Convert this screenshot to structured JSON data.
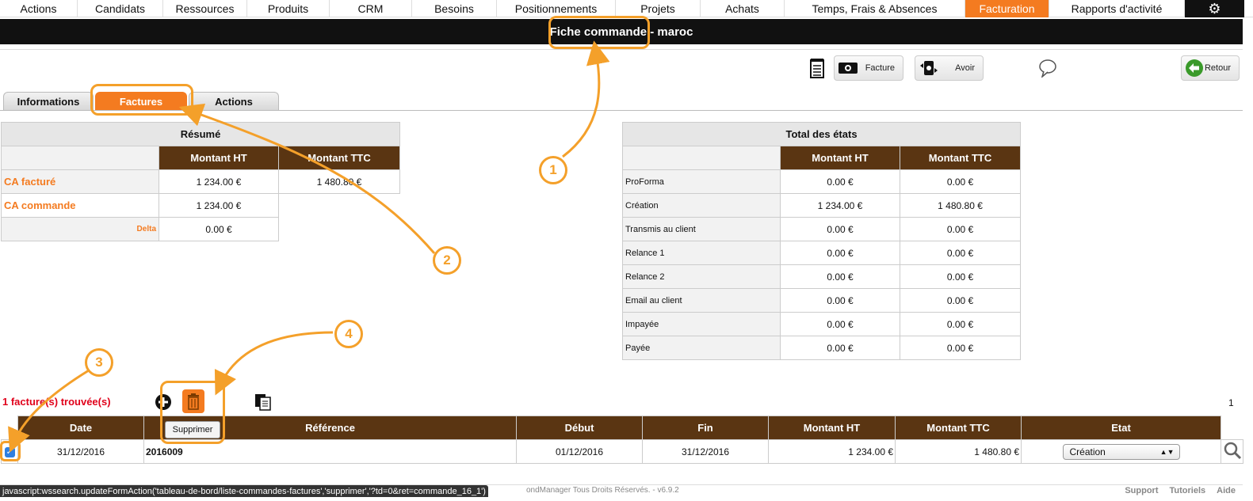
{
  "nav": {
    "items": [
      "Actions",
      "Candidats",
      "Ressources",
      "Produits",
      "CRM",
      "Besoins",
      "Positionnements",
      "Projets",
      "Achats",
      "Temps, Frais & Absences",
      "Facturation",
      "Rapports d'activité"
    ],
    "active": "Facturation",
    "gear_icon": "gear-icon"
  },
  "title": "Fiche commande - maroc",
  "toolbar": {
    "facture_label": "Facture",
    "avoir_label": "Avoir",
    "retour_label": "Retour"
  },
  "tabs": [
    "Informations",
    "Factures",
    "Actions"
  ],
  "active_tab": "Factures",
  "resume": {
    "title": "Résumé",
    "col_ht": "Montant HT",
    "col_ttc": "Montant TTC",
    "rows": [
      {
        "label": "CA facturé",
        "ht": "1 234.00 €",
        "ttc": "1 480.80 €"
      },
      {
        "label": "CA commande",
        "ht": "1 234.00 €",
        "ttc": ""
      },
      {
        "label": "Delta",
        "ht": "0.00 €",
        "ttc": ""
      }
    ]
  },
  "etats": {
    "title": "Total des états",
    "col_ht": "Montant HT",
    "col_ttc": "Montant TTC",
    "rows": [
      {
        "label": "ProForma",
        "ht": "0.00 €",
        "ttc": "0.00 €"
      },
      {
        "label": "Création",
        "ht": "1 234.00 €",
        "ttc": "1 480.80 €"
      },
      {
        "label": "Transmis au client",
        "ht": "0.00 €",
        "ttc": "0.00 €"
      },
      {
        "label": "Relance 1",
        "ht": "0.00 €",
        "ttc": "0.00 €"
      },
      {
        "label": "Relance 2",
        "ht": "0.00 €",
        "ttc": "0.00 €"
      },
      {
        "label": "Email au client",
        "ht": "0.00 €",
        "ttc": "0.00 €"
      },
      {
        "label": "Impayée",
        "ht": "0.00 €",
        "ttc": "0.00 €"
      },
      {
        "label": "Payée",
        "ht": "0.00 €",
        "ttc": "0.00 €"
      }
    ]
  },
  "results": {
    "found_text": "1 facture(s) trouvée(s)",
    "page": "1",
    "tooltip": "Supprimer",
    "columns": [
      "Date",
      "Référence",
      "Début",
      "Fin",
      "Montant HT",
      "Montant TTC",
      "Etat"
    ],
    "row": {
      "checked": true,
      "date": "31/12/2016",
      "reference": "2016009",
      "debut": "01/12/2016",
      "fin": "31/12/2016",
      "ht": "1 234.00 €",
      "ttc": "1 480.80 €",
      "etat": "Création"
    }
  },
  "footer": {
    "status_url": "javascript:wssearch.updateFormAction('tableau-de-bord/liste-commandes-factures','supprimer','?td=0&ret=commande_16_1')",
    "copyright": "ondManager Tous Droits Réservés. - v6.9.2",
    "links": [
      "Support",
      "Tutoriels",
      "Aide"
    ]
  },
  "annotations": [
    "1",
    "2",
    "3",
    "4"
  ],
  "colors": {
    "accent": "#f47b20",
    "brown": "#5a3512",
    "annotation": "#f4a02a",
    "found": "#e0001a"
  }
}
